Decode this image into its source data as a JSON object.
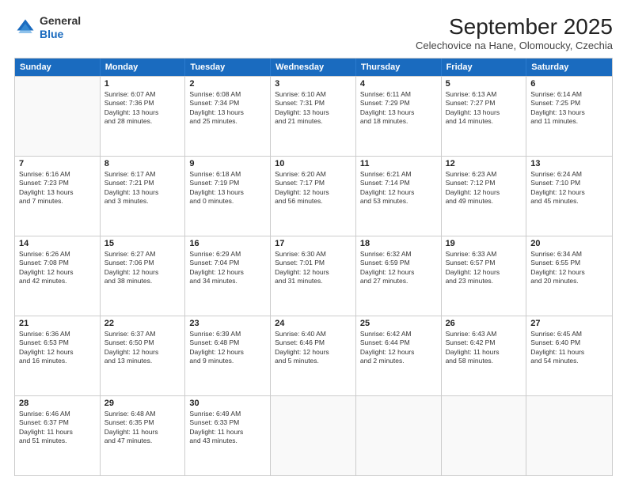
{
  "header": {
    "logo": {
      "general": "General",
      "blue": "Blue"
    },
    "month": "September 2025",
    "location": "Celechovice na Hane, Olomoucky, Czechia"
  },
  "weekdays": [
    "Sunday",
    "Monday",
    "Tuesday",
    "Wednesday",
    "Thursday",
    "Friday",
    "Saturday"
  ],
  "rows": [
    [
      {
        "day": "",
        "info": ""
      },
      {
        "day": "1",
        "info": "Sunrise: 6:07 AM\nSunset: 7:36 PM\nDaylight: 13 hours\nand 28 minutes."
      },
      {
        "day": "2",
        "info": "Sunrise: 6:08 AM\nSunset: 7:34 PM\nDaylight: 13 hours\nand 25 minutes."
      },
      {
        "day": "3",
        "info": "Sunrise: 6:10 AM\nSunset: 7:31 PM\nDaylight: 13 hours\nand 21 minutes."
      },
      {
        "day": "4",
        "info": "Sunrise: 6:11 AM\nSunset: 7:29 PM\nDaylight: 13 hours\nand 18 minutes."
      },
      {
        "day": "5",
        "info": "Sunrise: 6:13 AM\nSunset: 7:27 PM\nDaylight: 13 hours\nand 14 minutes."
      },
      {
        "day": "6",
        "info": "Sunrise: 6:14 AM\nSunset: 7:25 PM\nDaylight: 13 hours\nand 11 minutes."
      }
    ],
    [
      {
        "day": "7",
        "info": "Sunrise: 6:16 AM\nSunset: 7:23 PM\nDaylight: 13 hours\nand 7 minutes."
      },
      {
        "day": "8",
        "info": "Sunrise: 6:17 AM\nSunset: 7:21 PM\nDaylight: 13 hours\nand 3 minutes."
      },
      {
        "day": "9",
        "info": "Sunrise: 6:18 AM\nSunset: 7:19 PM\nDaylight: 13 hours\nand 0 minutes."
      },
      {
        "day": "10",
        "info": "Sunrise: 6:20 AM\nSunset: 7:17 PM\nDaylight: 12 hours\nand 56 minutes."
      },
      {
        "day": "11",
        "info": "Sunrise: 6:21 AM\nSunset: 7:14 PM\nDaylight: 12 hours\nand 53 minutes."
      },
      {
        "day": "12",
        "info": "Sunrise: 6:23 AM\nSunset: 7:12 PM\nDaylight: 12 hours\nand 49 minutes."
      },
      {
        "day": "13",
        "info": "Sunrise: 6:24 AM\nSunset: 7:10 PM\nDaylight: 12 hours\nand 45 minutes."
      }
    ],
    [
      {
        "day": "14",
        "info": "Sunrise: 6:26 AM\nSunset: 7:08 PM\nDaylight: 12 hours\nand 42 minutes."
      },
      {
        "day": "15",
        "info": "Sunrise: 6:27 AM\nSunset: 7:06 PM\nDaylight: 12 hours\nand 38 minutes."
      },
      {
        "day": "16",
        "info": "Sunrise: 6:29 AM\nSunset: 7:04 PM\nDaylight: 12 hours\nand 34 minutes."
      },
      {
        "day": "17",
        "info": "Sunrise: 6:30 AM\nSunset: 7:01 PM\nDaylight: 12 hours\nand 31 minutes."
      },
      {
        "day": "18",
        "info": "Sunrise: 6:32 AM\nSunset: 6:59 PM\nDaylight: 12 hours\nand 27 minutes."
      },
      {
        "day": "19",
        "info": "Sunrise: 6:33 AM\nSunset: 6:57 PM\nDaylight: 12 hours\nand 23 minutes."
      },
      {
        "day": "20",
        "info": "Sunrise: 6:34 AM\nSunset: 6:55 PM\nDaylight: 12 hours\nand 20 minutes."
      }
    ],
    [
      {
        "day": "21",
        "info": "Sunrise: 6:36 AM\nSunset: 6:53 PM\nDaylight: 12 hours\nand 16 minutes."
      },
      {
        "day": "22",
        "info": "Sunrise: 6:37 AM\nSunset: 6:50 PM\nDaylight: 12 hours\nand 13 minutes."
      },
      {
        "day": "23",
        "info": "Sunrise: 6:39 AM\nSunset: 6:48 PM\nDaylight: 12 hours\nand 9 minutes."
      },
      {
        "day": "24",
        "info": "Sunrise: 6:40 AM\nSunset: 6:46 PM\nDaylight: 12 hours\nand 5 minutes."
      },
      {
        "day": "25",
        "info": "Sunrise: 6:42 AM\nSunset: 6:44 PM\nDaylight: 12 hours\nand 2 minutes."
      },
      {
        "day": "26",
        "info": "Sunrise: 6:43 AM\nSunset: 6:42 PM\nDaylight: 11 hours\nand 58 minutes."
      },
      {
        "day": "27",
        "info": "Sunrise: 6:45 AM\nSunset: 6:40 PM\nDaylight: 11 hours\nand 54 minutes."
      }
    ],
    [
      {
        "day": "28",
        "info": "Sunrise: 6:46 AM\nSunset: 6:37 PM\nDaylight: 11 hours\nand 51 minutes."
      },
      {
        "day": "29",
        "info": "Sunrise: 6:48 AM\nSunset: 6:35 PM\nDaylight: 11 hours\nand 47 minutes."
      },
      {
        "day": "30",
        "info": "Sunrise: 6:49 AM\nSunset: 6:33 PM\nDaylight: 11 hours\nand 43 minutes."
      },
      {
        "day": "",
        "info": ""
      },
      {
        "day": "",
        "info": ""
      },
      {
        "day": "",
        "info": ""
      },
      {
        "day": "",
        "info": ""
      }
    ]
  ]
}
